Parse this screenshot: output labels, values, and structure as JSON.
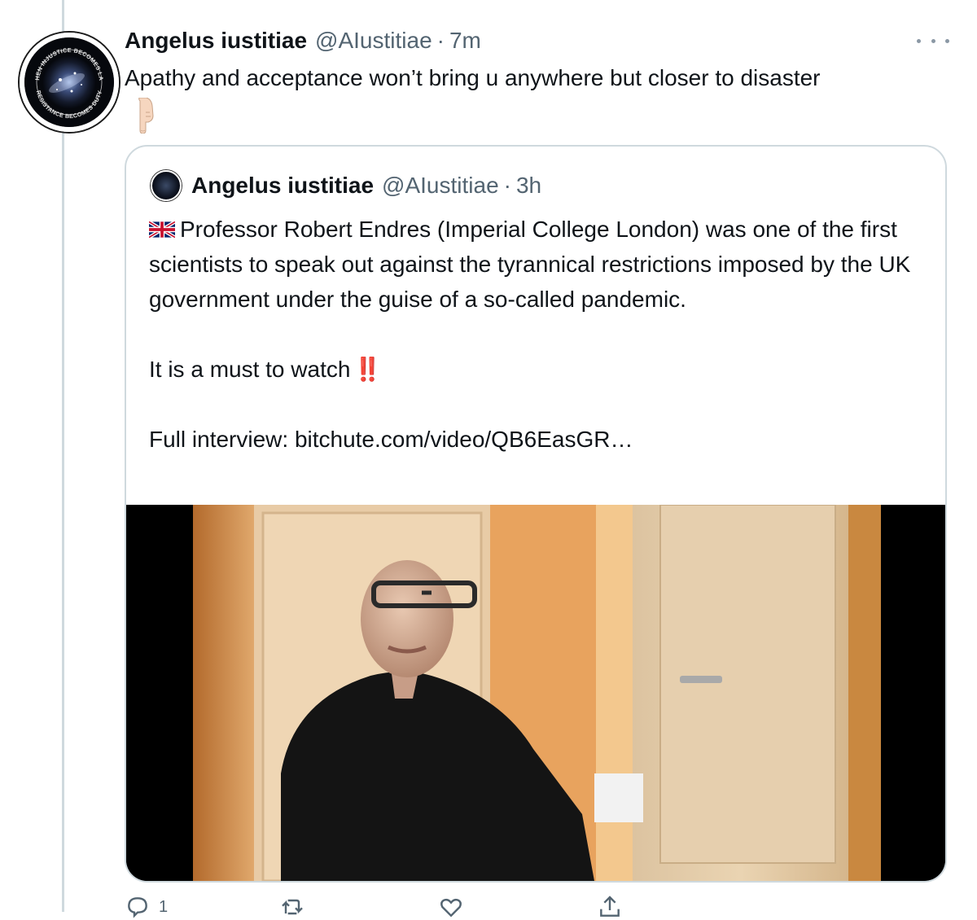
{
  "tweet": {
    "author_name": "Angelus iustitiae",
    "author_handle": "@AIustitiae",
    "separator": "·",
    "time": "7m",
    "text": "Apathy and acceptance won’t bring u anywhere but closer to disaster",
    "emoji": "👇🏻",
    "avatar_text_top": "WHEN INJUSTICE BECOMES LAW",
    "avatar_text_bottom": "RESISTANCE BECOMES DUTY"
  },
  "quoted_tweet": {
    "author_name": "Angelus iustitiae",
    "author_handle": "@AIustitiae",
    "separator": "·",
    "time": "3h",
    "flag_emoji": "🇬🇧",
    "paragraph_1": "Professor Robert Endres (Imperial College London) was one of the first scientists to speak out against the tyrannical restrictions imposed by the UK government under the guise of a so-called pandemic.",
    "paragraph_2": "It is a must to watch",
    "paragraph_2_emoji": "‼️",
    "paragraph_3": "Full interview: bitchute.com/video/QB6EasGR…"
  },
  "actions": {
    "reply_count": "1",
    "retweet_count": "",
    "like_count": "",
    "icons": [
      "reply-icon",
      "retweet-icon",
      "heart-icon",
      "share-icon"
    ]
  },
  "colors": {
    "text_primary": "#0f1419",
    "text_secondary": "#536471",
    "border": "#cfd9de",
    "thread_line": "#cfd9de",
    "alert_red": "#e0291d"
  }
}
